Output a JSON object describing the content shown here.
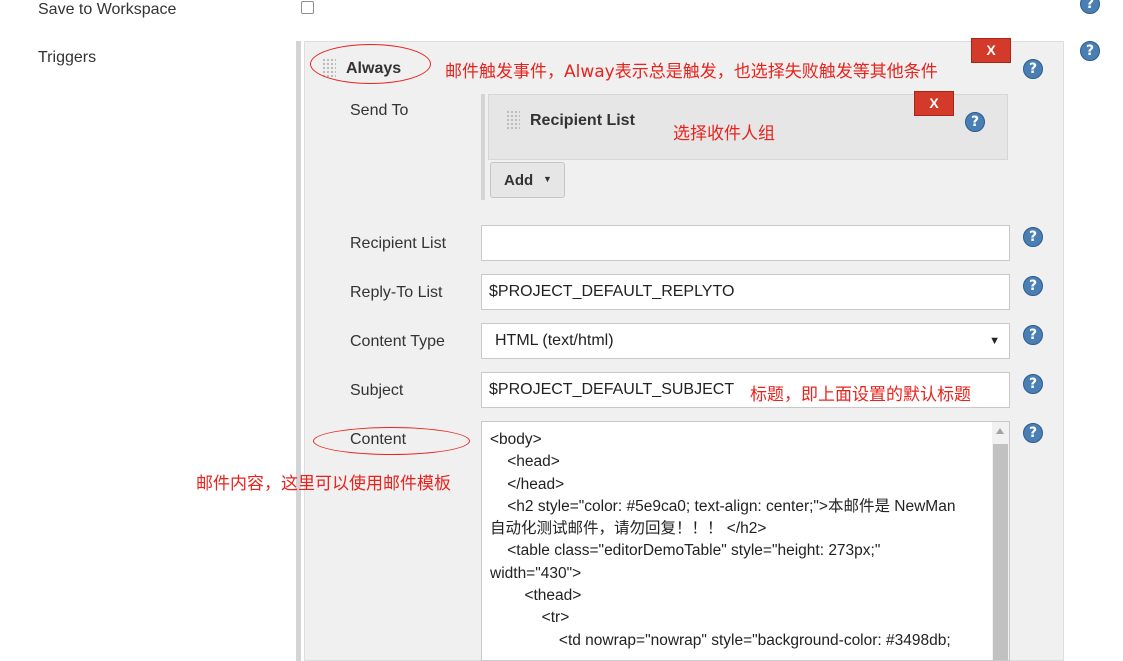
{
  "workspace": {
    "label": "Save to Workspace"
  },
  "triggers": {
    "label": "Triggers",
    "trigger_name": "Always",
    "remove_label": "X",
    "note": "邮件触发事件，Alway表示总是触发，也选择失败触发等其他条件"
  },
  "send_to": {
    "label": "Send To",
    "recipient_block_title": "Recipient List",
    "remove_label": "X",
    "note": "选择收件人组",
    "add_label": "Add"
  },
  "form": {
    "recipient_list": {
      "label": "Recipient List",
      "value": ""
    },
    "reply_to": {
      "label": "Reply-To List",
      "value": "$PROJECT_DEFAULT_REPLYTO"
    },
    "content_type": {
      "label": "Content Type",
      "value": "HTML (text/html)"
    },
    "subject": {
      "label": "Subject",
      "value": "$PROJECT_DEFAULT_SUBJECT",
      "note": "标题，即上面设置的默认标题"
    },
    "content": {
      "label": "Content",
      "note": "邮件内容，这里可以使用邮件模板",
      "lines": [
        "<body>",
        "    <head>",
        "    </head>",
        "    <h2 style=\"color: #5e9ca0; text-align: center;\">本邮件是 NewMan",
        "自动化测试邮件，请勿回复！！！ </h2>",
        "    <table class=\"editorDemoTable\" style=\"height: 273px;\"",
        "width=\"430\">",
        "        <thead>",
        "            <tr>",
        "                <td nowrap=\"nowrap\" style=\"background-color: #3498db;"
      ]
    }
  },
  "help_symbol": "?",
  "dropdown_arrow": "▼",
  "colors": {
    "note_red": "#e8231d",
    "delete_red": "#d33a29",
    "help_blue": "#4a7fb5"
  }
}
